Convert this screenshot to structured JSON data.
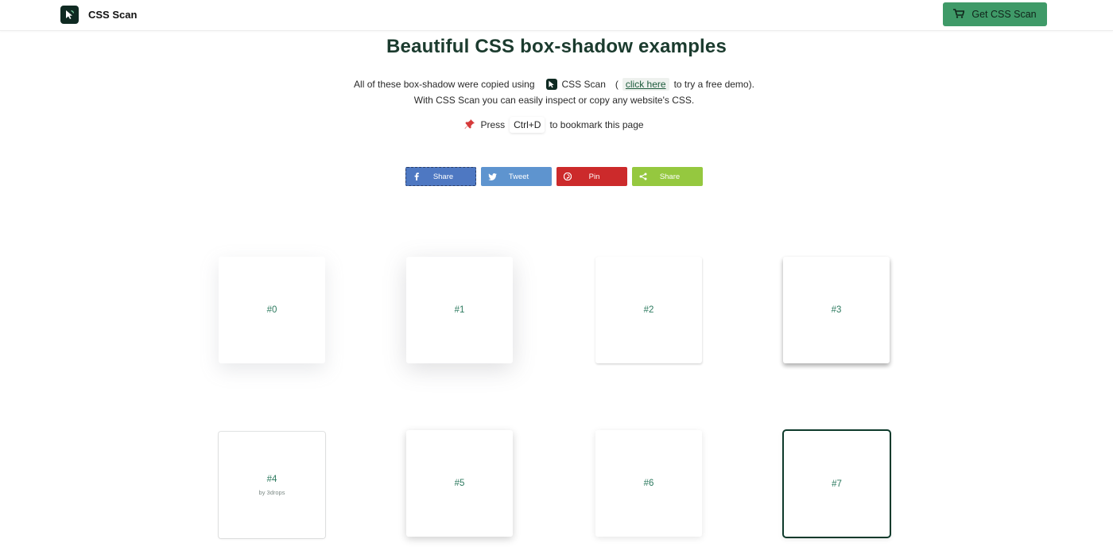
{
  "nav": {
    "brand_name": "CSS Scan",
    "cta_label": "Get CSS Scan"
  },
  "hero": {
    "title": "Beautiful CSS box-shadow examples",
    "line1_prefix": "All of these box-shadow were copied using",
    "line1_brand": "CSS Scan",
    "line1_open": "(",
    "line1_link": "click here",
    "line1_suffix": "to try a free demo).",
    "line2": "With CSS Scan you can easily inspect or copy any website's CSS.",
    "press": "Press",
    "shortcut": "Ctrl+D",
    "bookmark": "to bookmark this page"
  },
  "share": {
    "facebook": "Share",
    "twitter": "Tweet",
    "pinterest": "Pin",
    "generic": "Share"
  },
  "boxes": [
    {
      "label": "#0"
    },
    {
      "label": "#1"
    },
    {
      "label": "#2"
    },
    {
      "label": "#3"
    },
    {
      "label": "#4",
      "credit": "by 3drops"
    },
    {
      "label": "#5"
    },
    {
      "label": "#6"
    },
    {
      "label": "#7"
    }
  ],
  "colors": {
    "accent": "#3f9a68",
    "title": "#1b3b2e",
    "box_label": "#2d7a5f",
    "facebook": "#4e78c2",
    "twitter": "#5e94cf",
    "pinterest": "#cc2a2b",
    "generic_share": "#95c83f"
  },
  "icons": {
    "logo": "cursor-icon",
    "cta": "cart-icon",
    "press": "pushpin-icon",
    "facebook": "facebook-icon",
    "twitter": "twitter-icon",
    "pinterest": "pinterest-icon",
    "generic": "share-icon"
  }
}
